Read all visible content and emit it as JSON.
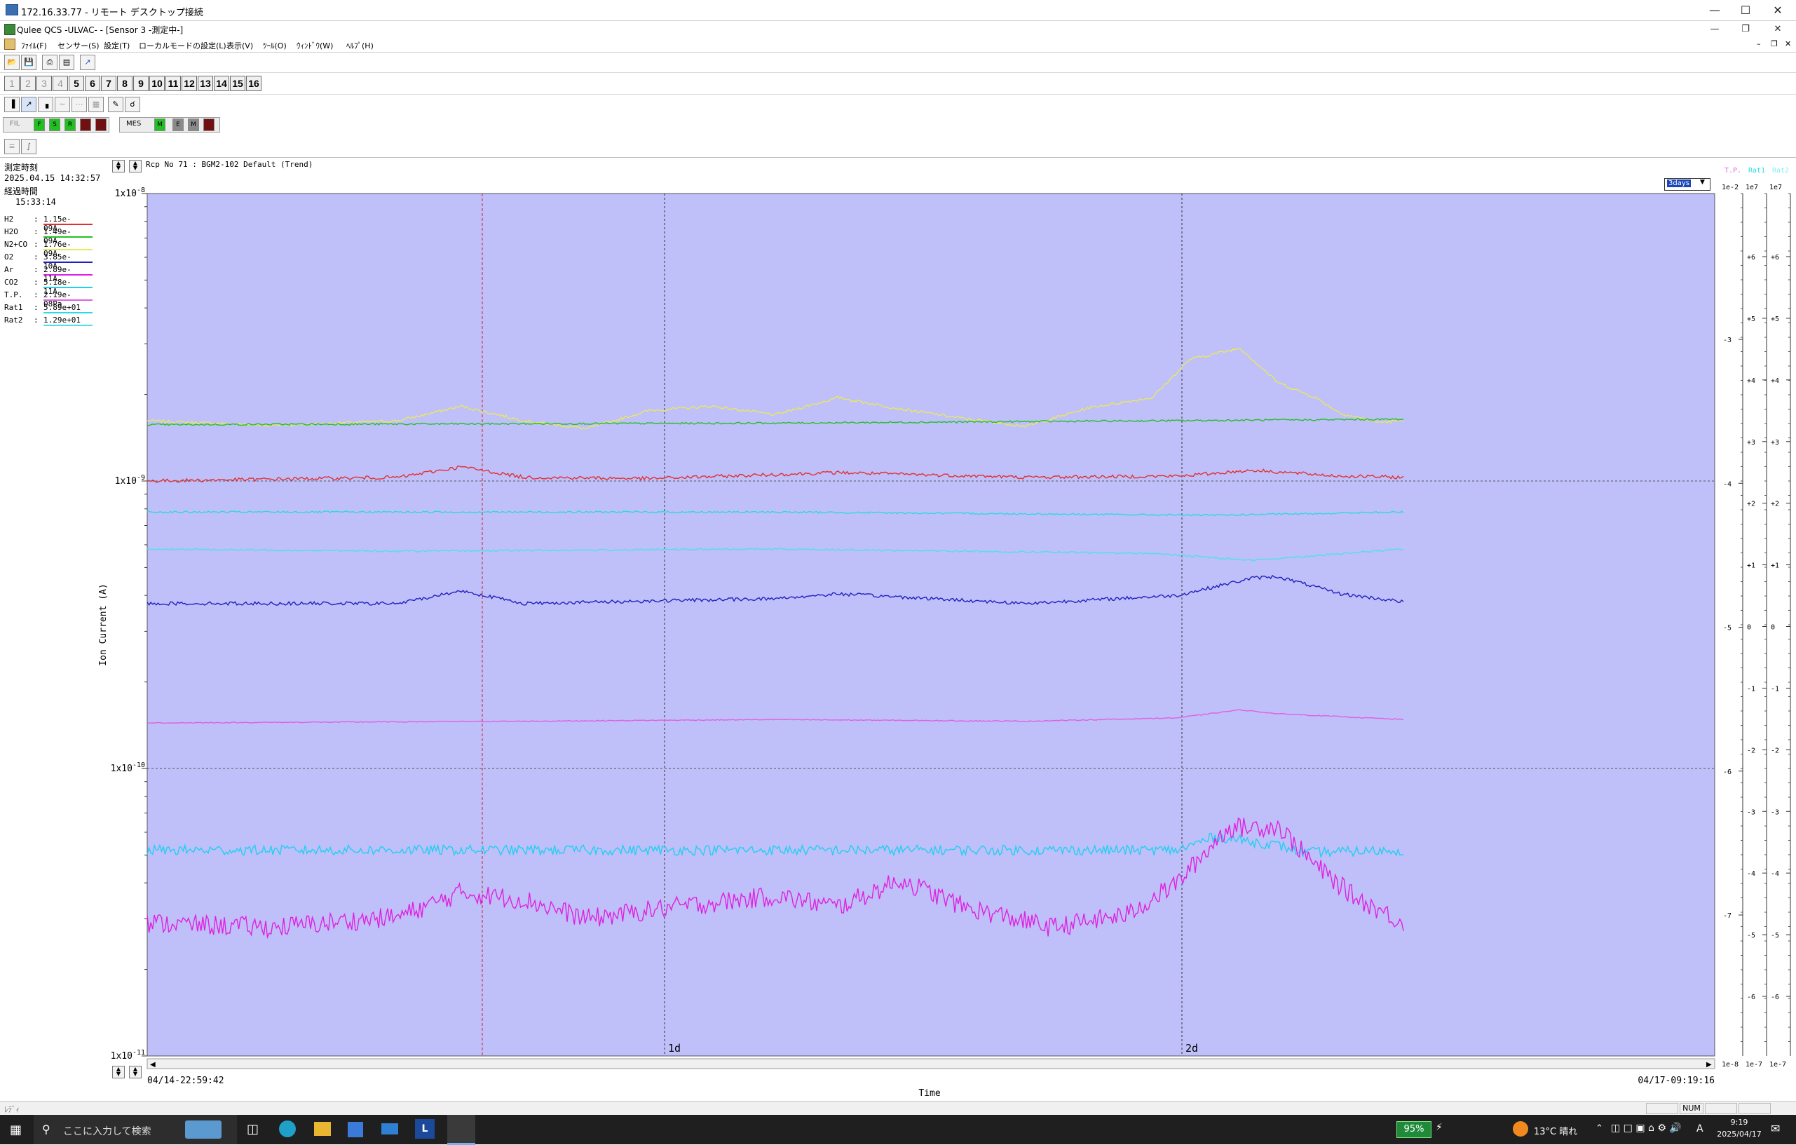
{
  "remote_window": {
    "title": "172.16.33.77 - リモート デスクトップ接続"
  },
  "app": {
    "title": "Qulee QCS -ULVAC- - [Sensor 3 -測定中-]",
    "menu": [
      "ﾌｧｲﾙ(F)",
      "センサー(S)",
      "設定(T)",
      "ローカルモードの設定(L)",
      "表示(V)",
      "ﾂｰﾙ(O)",
      "ｳｨﾝﾄﾞｳ(W)",
      "ﾍﾙﾌﾟ(H)"
    ],
    "sensor_tabs": [
      "1",
      "2",
      "3",
      "4",
      "5",
      "6",
      "7",
      "8",
      "9",
      "10",
      "11",
      "12",
      "13",
      "14",
      "15",
      "16"
    ],
    "filament_label": "FIL",
    "filament_buttons": [
      "F",
      "S",
      "R",
      "",
      ""
    ],
    "mes_label": "MES",
    "mes_buttons": [
      "M",
      "E",
      "M",
      ""
    ]
  },
  "panel": {
    "measure_time_label": "測定時刻",
    "measure_time": "2025.04.15 14:32:57",
    "elapsed_label": "経過時間",
    "elapsed": "15:33:14",
    "legend": [
      {
        "name": "H2",
        "value": "1.15e-09A",
        "color": "#e03030"
      },
      {
        "name": "H2O",
        "value": "1.49e-09A",
        "color": "#22c022"
      },
      {
        "name": "N2+CO",
        "value": "1.76e-09A",
        "color": "#e8e860"
      },
      {
        "name": "O2",
        "value": "3.85e-10A",
        "color": "#2020c0"
      },
      {
        "name": "Ar",
        "value": "2.89e-11A",
        "color": "#e020e0"
      },
      {
        "name": "CO2",
        "value": "5.18e-11A",
        "color": "#20d0f0"
      },
      {
        "name": "T.P.",
        "value": "2.19e-08Pa",
        "color": "#e060e0"
      },
      {
        "name": "Rat1",
        "value": "5.89e+01",
        "color": "#30d8e0"
      },
      {
        "name": "Rat2",
        "value": "1.29e+01",
        "color": "#50e0e8"
      }
    ]
  },
  "chart_header": {
    "recipe": "Rcp No 71 : BGM2-102 Default (Trend)",
    "range_select": "3days"
  },
  "chart_data": {
    "type": "line",
    "xlabel": "Time",
    "ylabel": "Ion Current (A)",
    "x_start": "04/14-22:59:42",
    "x_end": "04/17-09:19:16",
    "x_marks": [
      "1d",
      "2d"
    ],
    "y_scale": "log",
    "ylim": [
      1e-11,
      1e-08
    ],
    "y_ticks": [
      "1x10-11",
      "1x10-10",
      "1x10-9",
      "1x10-8"
    ],
    "right_axes": [
      {
        "name": "T.P.",
        "top": "1e-2",
        "bottom": "1e-8",
        "ticks": [
          "-3",
          "-4",
          "-5",
          "-6",
          "-7"
        ]
      },
      {
        "name": "Rat1",
        "top": "1e7",
        "bottom": "1e-7",
        "ticks": [
          "+6",
          "+5",
          "+4",
          "+3",
          "+2",
          "+1",
          "0",
          "-1",
          "-2",
          "-3",
          "-4",
          "-5",
          "-6"
        ]
      },
      {
        "name": "Rat2",
        "top": "1e7",
        "bottom": "1e-7",
        "ticks": [
          "+6",
          "+5",
          "+4",
          "+3",
          "+2",
          "+1",
          "0",
          "-1",
          "-2",
          "-3",
          "-4",
          "-5",
          "-6"
        ]
      }
    ],
    "series": [
      {
        "name": "N2+CO",
        "color": "#e8e860",
        "x": [
          0,
          0.1,
          0.2,
          0.25,
          0.3,
          0.35,
          0.4,
          0.45,
          0.5,
          0.55,
          0.6,
          0.65,
          0.7,
          0.75,
          0.8,
          0.83,
          0.87,
          0.9,
          0.93,
          0.95,
          0.98,
          1.0
        ],
        "values": [
          1.62e-09,
          1.56e-09,
          1.62e-09,
          1.82e-09,
          1.62e-09,
          1.52e-09,
          1.76e-09,
          1.82e-09,
          1.7e-09,
          1.95e-09,
          1.78e-09,
          1.65e-09,
          1.55e-09,
          1.8e-09,
          1.95e-09,
          2.65e-09,
          2.9e-09,
          2.2e-09,
          1.95e-09,
          1.72e-09,
          1.6e-09,
          1.62e-09
        ]
      },
      {
        "name": "H2O",
        "color": "#22c022",
        "x": [
          0,
          0.5,
          1.0
        ],
        "values": [
          1.57e-09,
          1.59e-09,
          1.64e-09
        ]
      },
      {
        "name": "H2",
        "color": "#e03030",
        "x": [
          0,
          0.2,
          0.25,
          0.3,
          0.4,
          0.55,
          0.7,
          0.82,
          0.88,
          0.95,
          1.0
        ],
        "values": [
          1e-09,
          1.03e-09,
          1.12e-09,
          1.03e-09,
          1.02e-09,
          1.07e-09,
          1.03e-09,
          1.04e-09,
          1.09e-09,
          1.04e-09,
          1.03e-09
        ]
      },
      {
        "name": "Rat1",
        "color": "#30d8e0",
        "x": [
          0,
          0.5,
          0.85,
          1.0
        ],
        "values": [
          7.8e-10,
          7.8e-10,
          7.6e-10,
          7.8e-10
        ]
      },
      {
        "name": "Rat2",
        "color": "#50e0e8",
        "x": [
          0,
          0.2,
          0.5,
          0.8,
          0.88,
          1.0
        ],
        "values": [
          5.8e-10,
          5.7e-10,
          5.8e-10,
          5.6e-10,
          5.3e-10,
          5.8e-10
        ]
      },
      {
        "name": "O2",
        "color": "#2020c0",
        "x": [
          0,
          0.2,
          0.25,
          0.3,
          0.5,
          0.55,
          0.7,
          0.82,
          0.88,
          0.9,
          0.95,
          1.0
        ],
        "values": [
          3.75e-10,
          3.75e-10,
          4.15e-10,
          3.75e-10,
          3.9e-10,
          4.05e-10,
          3.75e-10,
          4e-10,
          4.6e-10,
          4.65e-10,
          4.05e-10,
          3.8e-10
        ]
      },
      {
        "name": "T.P.",
        "color": "#e060e0",
        "x": [
          0,
          0.3,
          0.5,
          0.7,
          0.82,
          0.87,
          0.9,
          1.0
        ],
        "values": [
          1.44e-10,
          1.46e-10,
          1.48e-10,
          1.46e-10,
          1.5e-10,
          1.6e-10,
          1.55e-10,
          1.48e-10
        ]
      },
      {
        "name": "CO2",
        "color": "#20d0f0",
        "x": [
          0,
          0.5,
          0.82,
          0.85,
          0.9,
          0.92,
          1.0
        ],
        "values": [
          5.2e-11,
          5.2e-11,
          5.2e-11,
          5.8e-11,
          5.4e-11,
          5.1e-11,
          5.2e-11
        ]
      },
      {
        "name": "Ar",
        "color": "#e020e0",
        "x": [
          0,
          0.1,
          0.2,
          0.25,
          0.3,
          0.35,
          0.42,
          0.5,
          0.55,
          0.6,
          0.65,
          0.72,
          0.78,
          0.82,
          0.86,
          0.9,
          0.93,
          0.96,
          1.0
        ],
        "values": [
          2.9e-11,
          2.8e-11,
          3.05e-11,
          3.7e-11,
          3.5e-11,
          3e-11,
          3.3e-11,
          3.6e-11,
          3.3e-11,
          4.1e-11,
          3.3e-11,
          2.8e-11,
          3.1e-11,
          4e-11,
          6.2e-11,
          6.3e-11,
          4.6e-11,
          3.6e-11,
          2.9e-11
        ]
      }
    ]
  },
  "status_bar": {
    "left": "ﾚﾃﾞｨ",
    "num": "NUM"
  },
  "taskbar": {
    "search_placeholder": "ここに入力して検索",
    "battery": "95%",
    "weather": "13°C 晴れ",
    "time": "9:19",
    "date": "2025/04/17",
    "ime": "A"
  }
}
